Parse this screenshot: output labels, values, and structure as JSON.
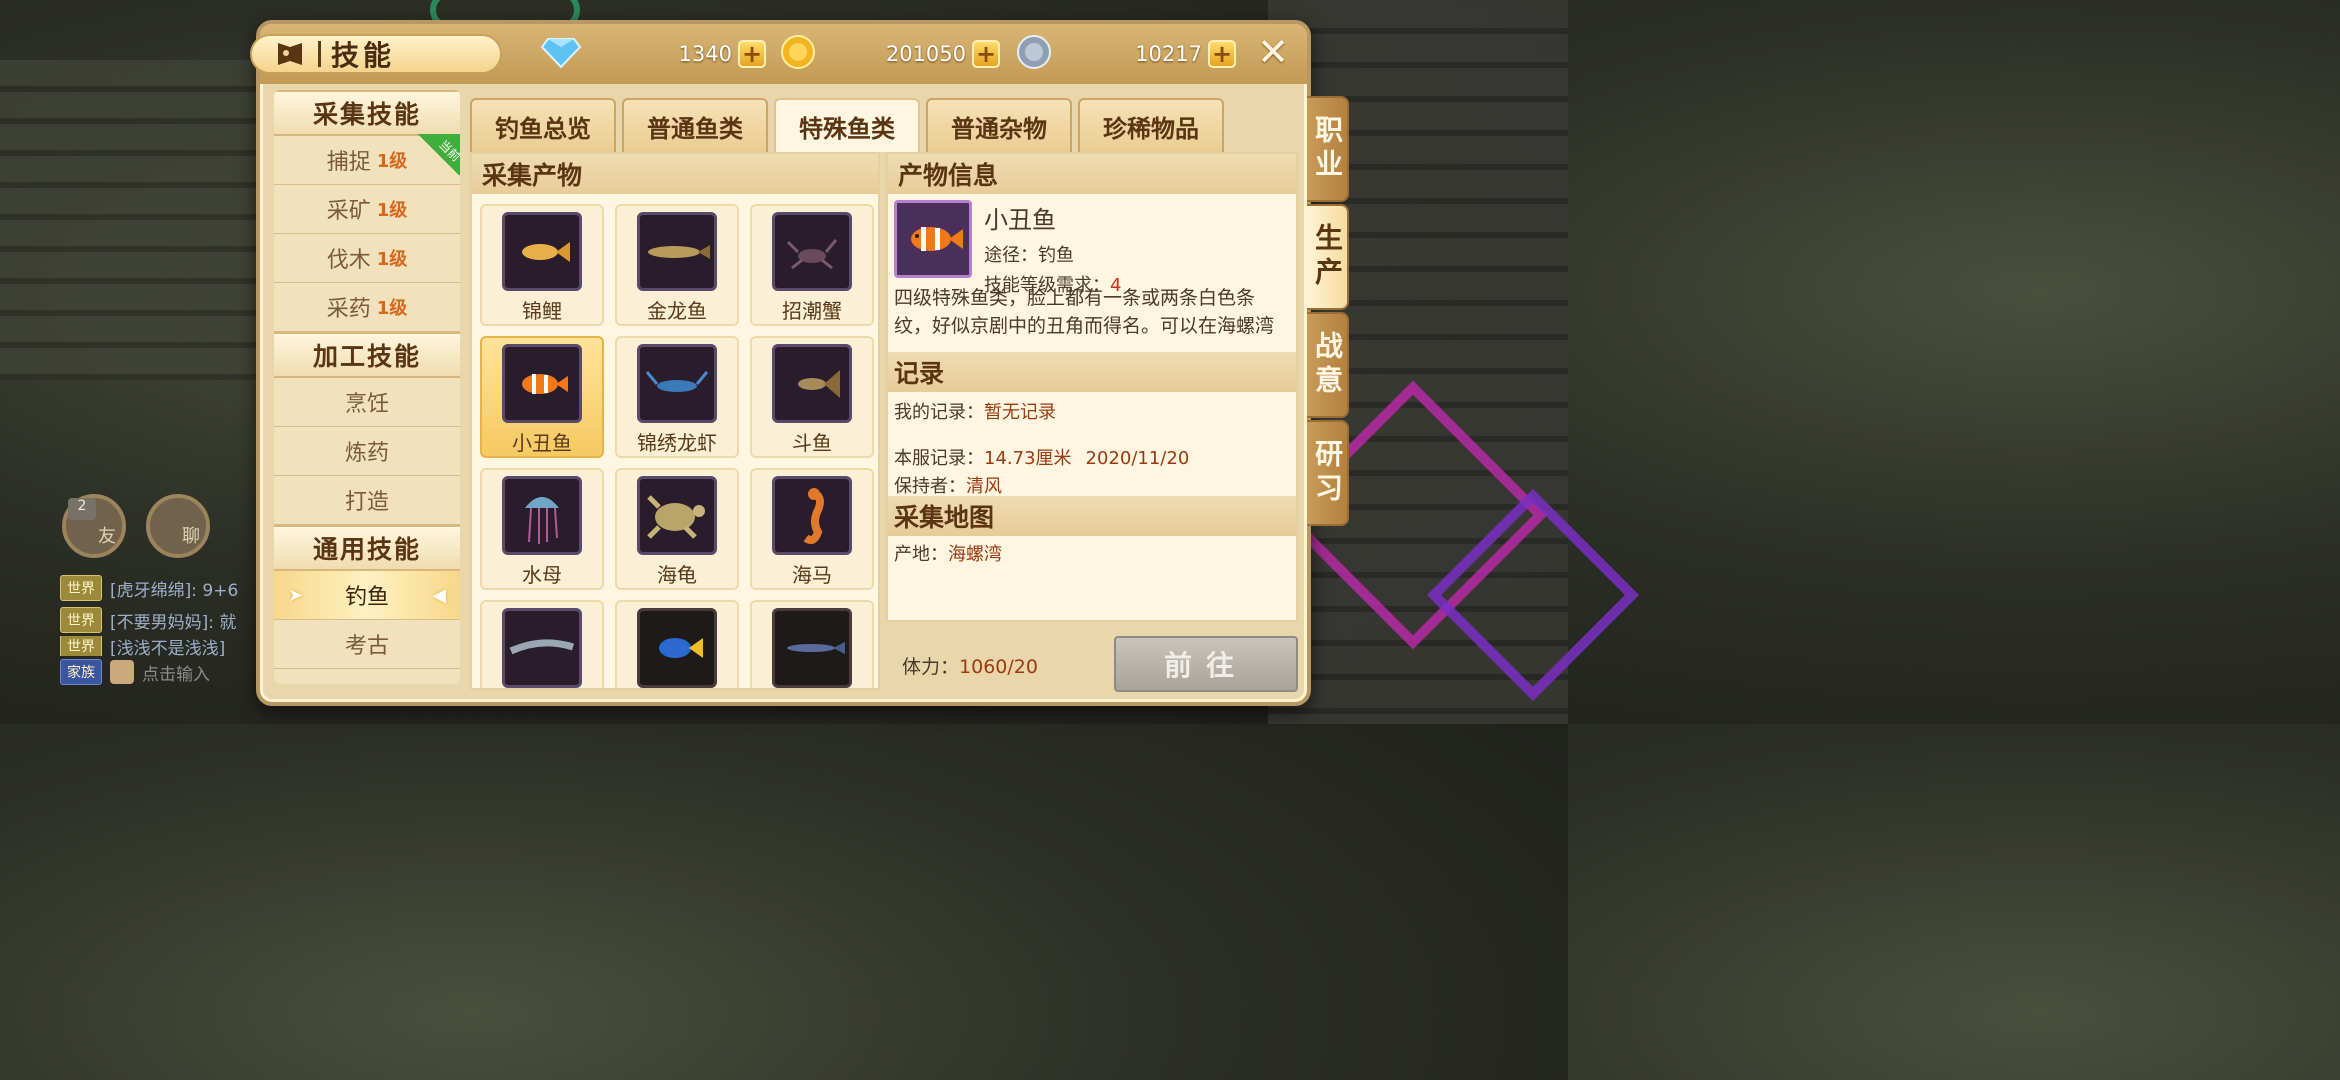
{
  "header": {
    "title": "技能",
    "currencies": [
      {
        "icon": "diamond-icon",
        "value": "1340"
      },
      {
        "icon": "gold-coin-icon",
        "value": "201050"
      },
      {
        "icon": "silver-coin-icon",
        "value": "10217"
      }
    ],
    "plus_label": "+",
    "close_label": "✕"
  },
  "left": {
    "gather_title": "采集技能",
    "gather": [
      {
        "name": "捕捉",
        "level": "1级"
      },
      {
        "name": "采矿",
        "level": "1级"
      },
      {
        "name": "伐木",
        "level": "1级"
      },
      {
        "name": "采药",
        "level": "1级"
      }
    ],
    "current_badge": "当前",
    "process_title": "加工技能",
    "process": [
      "烹饪",
      "炼药",
      "打造"
    ],
    "general_title": "通用技能",
    "general": [
      "钓鱼",
      "考古"
    ]
  },
  "tabs": [
    "钓鱼总览",
    "普通鱼类",
    "特殊鱼类",
    "普通杂物",
    "珍稀物品"
  ],
  "active_tab": 2,
  "products": {
    "title": "采集产物",
    "items": [
      {
        "name": "锦鲤",
        "icon": "koi-icon"
      },
      {
        "name": "金龙鱼",
        "icon": "arowana-icon"
      },
      {
        "name": "招潮蟹",
        "icon": "crab-icon"
      },
      {
        "name": "小丑鱼",
        "icon": "clownfish-icon"
      },
      {
        "name": "锦绣龙虾",
        "icon": "lobster-icon"
      },
      {
        "name": "斗鱼",
        "icon": "bettafish-icon"
      },
      {
        "name": "水母",
        "icon": "jellyfish-icon"
      },
      {
        "name": "海龟",
        "icon": "turtle-icon"
      },
      {
        "name": "海马",
        "icon": "seahorse-icon"
      },
      {
        "name": "",
        "icon": "ribbonfish-icon"
      },
      {
        "name": "",
        "icon": "tang-fish-icon"
      },
      {
        "name": "",
        "icon": "needlefish-icon"
      }
    ],
    "selected": 3
  },
  "info": {
    "title": "产物信息",
    "name": "小丑鱼",
    "route_label": "途径：",
    "route": "钓鱼",
    "req_label": "技能等级需求：",
    "req": "4",
    "desc": "四级特殊鱼类，脸上都有一条或两条白色条纹，好似京剧中的丑角而得名。可以在海螺湾",
    "record_title": "记录",
    "my_record_label": "我的记录：",
    "my_record": "暂无记录",
    "server_record_label": "本服记录：",
    "server_record": "14.73厘米",
    "server_record_date": "2020/11/20",
    "holder_label": "保持者：",
    "holder": "清风",
    "map_title": "采集地图",
    "origin_label": "产地：",
    "origin": "海螺湾"
  },
  "stamina_label": "体力：",
  "stamina": "1060/20",
  "go_label": "前往",
  "side_tabs": [
    "职业",
    "生产",
    "战意",
    "研习"
  ],
  "active_side": 1,
  "chat": {
    "friends_count": "2",
    "friends_label": "友",
    "chat_label": "聊",
    "lines": [
      {
        "tag": "世界",
        "text": "[虎牙绵绵]: 9+6"
      },
      {
        "tag": "世界",
        "text": "[不要男妈妈]: 就"
      },
      {
        "tag": "世界",
        "text": "[浅浅不是浅浅]"
      }
    ],
    "family_tag": "家族",
    "input_placeholder": "点击输入"
  }
}
